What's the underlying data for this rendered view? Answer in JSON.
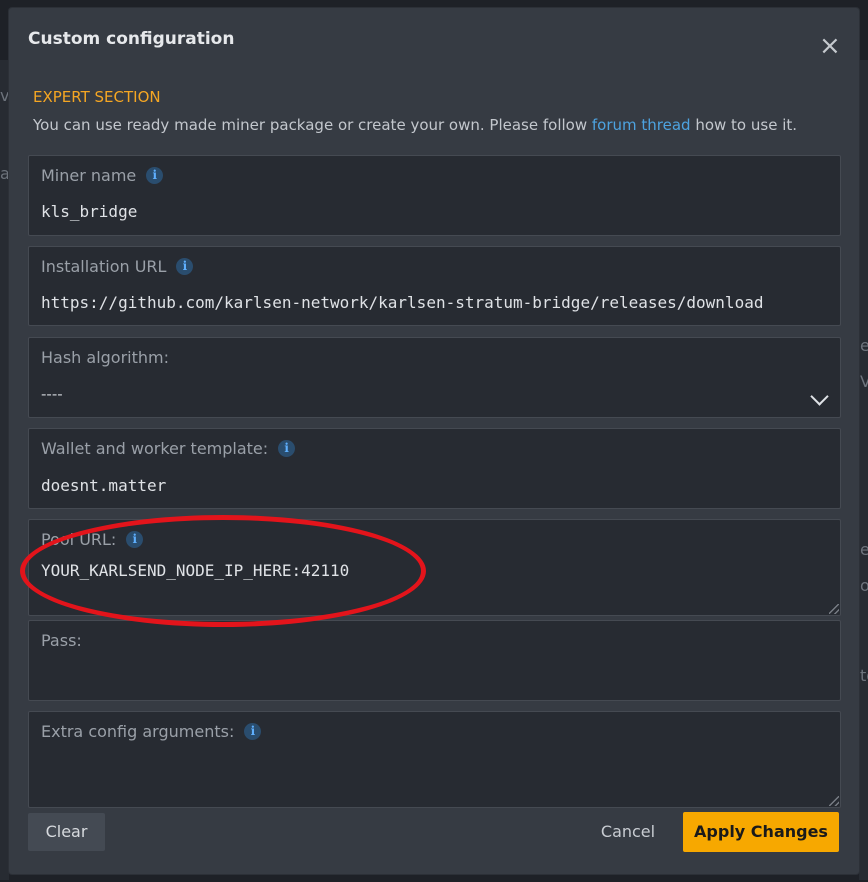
{
  "background": {
    "left_chars": [
      "v",
      "a"
    ],
    "right_chars": [
      "e",
      "V",
      "e",
      "o",
      "to"
    ]
  },
  "modal": {
    "title": "Custom configuration",
    "close_icon": "close-icon",
    "expert_title": "EXPERT SECTION",
    "expert_desc_before": "You can use ready made miner package or create your own. Please follow ",
    "expert_desc_link": "forum thread",
    "expert_desc_after": " how to use it."
  },
  "fields": {
    "miner_name": {
      "label": "Miner name",
      "value": "kls_bridge"
    },
    "install_url": {
      "label": "Installation URL",
      "value": "https://github.com/karlsen-network/karlsen-stratum-bridge/releases/download"
    },
    "hash_algorithm": {
      "label": "Hash algorithm:",
      "value": "----"
    },
    "wallet_template": {
      "label": "Wallet and worker template:",
      "value": "doesnt.matter"
    },
    "pool_url": {
      "label": "Pool URL:",
      "value": "YOUR_KARLSEND_NODE_IP_HERE:42110"
    },
    "pass": {
      "label": "Pass:",
      "value": ""
    },
    "extra_config": {
      "label": "Extra config arguments:",
      "value": ""
    }
  },
  "buttons": {
    "clear": "Clear",
    "cancel": "Cancel",
    "apply": "Apply Changes"
  },
  "colors": {
    "accent": "#f7a800",
    "link": "#4da3e0",
    "highlight": "#e3141b"
  },
  "info_glyph": "i"
}
